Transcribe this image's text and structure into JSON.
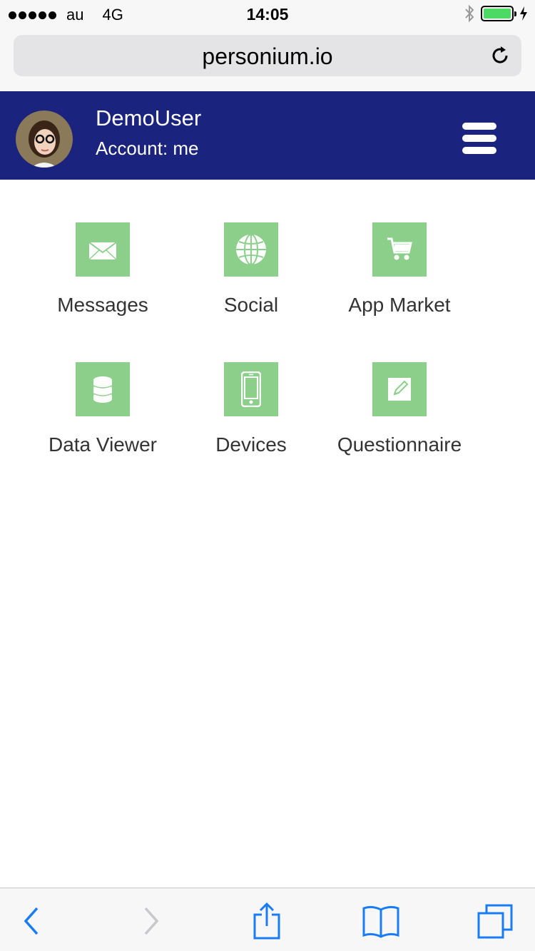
{
  "status_bar": {
    "carrier": "au",
    "network": "4G",
    "time": "14:05"
  },
  "browser": {
    "url": "personium.io"
  },
  "header": {
    "user_name": "DemoUser",
    "account": "Account: me"
  },
  "apps": [
    {
      "label": "Messages",
      "icon": "envelope-icon"
    },
    {
      "label": "Social",
      "icon": "globe-icon"
    },
    {
      "label": "App Market",
      "icon": "cart-icon"
    },
    {
      "label": "Data Viewer",
      "icon": "database-icon"
    },
    {
      "label": "Devices",
      "icon": "phone-icon"
    },
    {
      "label": "Questionnaire",
      "icon": "edit-icon"
    }
  ],
  "colors": {
    "header_bg": "#1a237e",
    "tile_bg": "#8ccf8a",
    "ios_blue": "#1a7cf5"
  }
}
